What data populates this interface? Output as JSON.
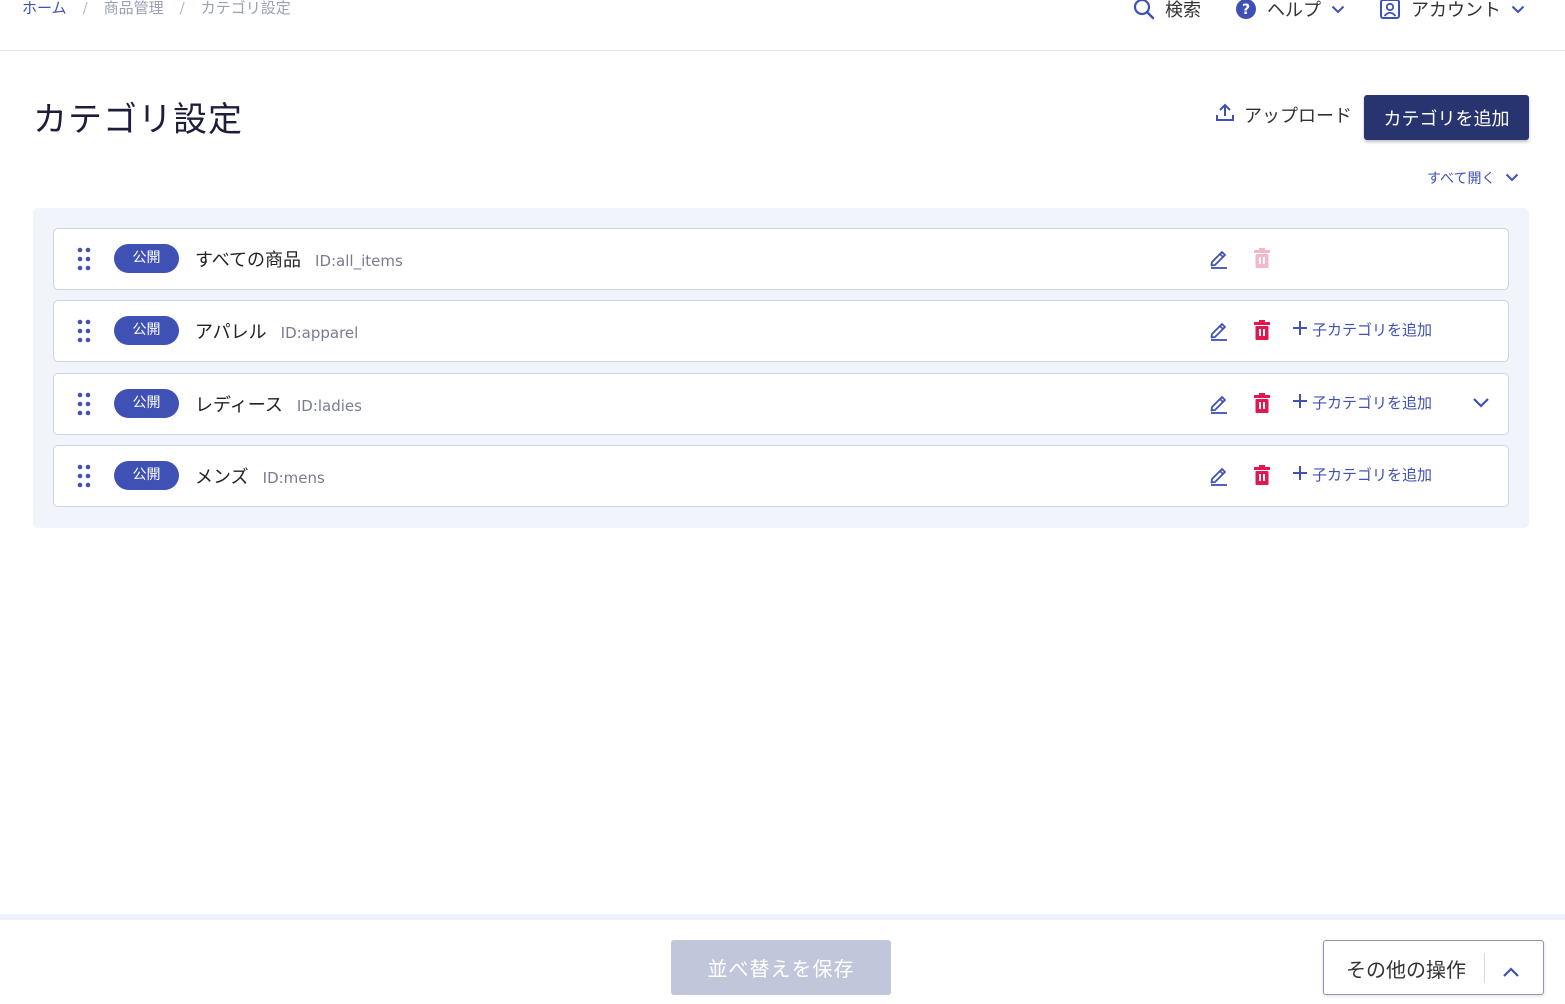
{
  "breadcrumb": {
    "items": [
      "ホーム",
      "商品管理",
      "カテゴリ設定"
    ],
    "separator": "/"
  },
  "topnav": {
    "search": "検索",
    "help": "ヘルプ",
    "account": "アカウント"
  },
  "page": {
    "title": "カテゴリ設定",
    "upload_label": "アップロード",
    "add_category_label": "カテゴリを追加",
    "expand_all_label": "すべて開く"
  },
  "categories": [
    {
      "status": "公開",
      "name": "すべての商品",
      "id": "ID:all_items",
      "deletable": false,
      "add_child_label": "",
      "expandable": false
    },
    {
      "status": "公開",
      "name": "アパレル",
      "id": "ID:apparel",
      "deletable": true,
      "add_child_label": "子カテゴリを追加",
      "expandable": false
    },
    {
      "status": "公開",
      "name": "レディース",
      "id": "ID:ladies",
      "deletable": true,
      "add_child_label": "子カテゴリを追加",
      "expandable": true
    },
    {
      "status": "公開",
      "name": "メンズ",
      "id": "ID:mens",
      "deletable": true,
      "add_child_label": "子カテゴリを追加",
      "expandable": false
    }
  ],
  "footer": {
    "save_order_label": "並べ替えを保存",
    "other_actions_label": "その他の操作"
  },
  "colors": {
    "primary": "#3f51b5",
    "primary_dark": "#283470",
    "danger": "#e0184f",
    "danger_disabled": "#f4b8c6",
    "disabled_button": "#c2c6da"
  }
}
